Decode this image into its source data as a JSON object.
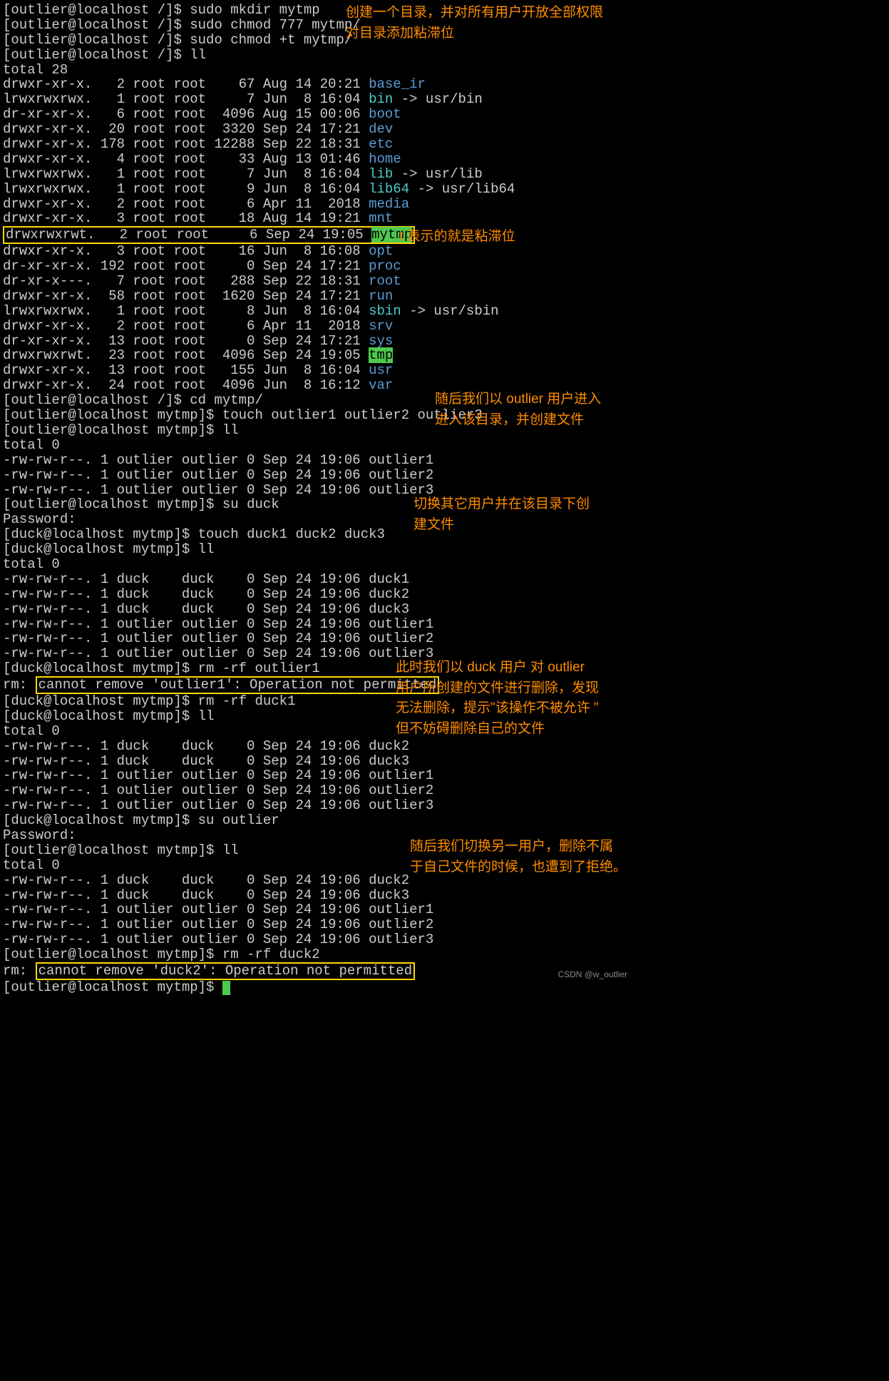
{
  "annotations": {
    "a1_l1": "创建一个目录，并对所有用户开放全部权限",
    "a1_l2": "对目录添加粘滞位",
    "a2": "t 表示的就是粘滞位",
    "a3_l1": "随后我们以 outlier 用户进入",
    "a3_l2": "进入该目录，并创建文件",
    "a4_l1": "切换其它用户并在该目录下创",
    "a4_l2": "建文件",
    "a5_l1": "此时我们以 duck 用户 对 outlier",
    "a5_l2": "用户所创建的文件进行删除，发现",
    "a5_l3": "无法删除，提示\"该操作不被允许  \"",
    "a5_l4": "但不妨碍删除自己的文件",
    "a6_l1": "随后我们切换另一用户，删除不属",
    "a6_l2": "于自己文件的时候，也遭到了拒绝。"
  },
  "prompts": {
    "outlier_root": "[outlier@localhost /]$ ",
    "outlier_mytmp": "[outlier@localhost mytmp]$ ",
    "duck_mytmp": "[duck@localhost mytmp]$ "
  },
  "cmds": {
    "mkdir": "sudo mkdir mytmp",
    "chmod777": "sudo chmod 777 mytmp/",
    "chmodt": "sudo chmod +t mytmp/",
    "ll": "ll",
    "cd": "cd mytmp/",
    "touch_out": "touch outlier1 outlier2 outlier3",
    "su_duck": "su duck",
    "touch_duck": "touch duck1 duck2 duck3",
    "rm_out1": "rm -rf outlier1",
    "rm_duck1": "rm -rf duck1",
    "su_out": "su outlier",
    "rm_duck2": "rm -rf duck2"
  },
  "text": {
    "total28": "total 28",
    "total0": "total 0",
    "password": "Password:",
    "rm_prefix": "rm: ",
    "err1": "cannot remove 'outlier1': Operation not permitted",
    "err2": "cannot remove 'duck2': Operation not permitted"
  },
  "ll_root": [
    {
      "perm": "drwxr-xr-x.",
      "n": "  2",
      "o": "root root",
      "sz": "   67",
      "dt": "Aug 14 20:21",
      "nm": "base_ir",
      "c": "blue"
    },
    {
      "perm": "lrwxrwxrwx.",
      "n": "  1",
      "o": "root root",
      "sz": "    7",
      "dt": "Jun  8 16:04",
      "nm": "bin",
      "link": " -> usr/bin",
      "c": "cyan"
    },
    {
      "perm": "dr-xr-xr-x.",
      "n": "  6",
      "o": "root root",
      "sz": " 4096",
      "dt": "Aug 15 00:06",
      "nm": "boot",
      "c": "blue"
    },
    {
      "perm": "drwxr-xr-x.",
      "n": " 20",
      "o": "root root",
      "sz": " 3320",
      "dt": "Sep 24 17:21",
      "nm": "dev",
      "c": "blue"
    },
    {
      "perm": "drwxr-xr-x.",
      "n": "178",
      "o": "root root",
      "sz": "12288",
      "dt": "Sep 22 18:31",
      "nm": "etc",
      "c": "blue"
    },
    {
      "perm": "drwxr-xr-x.",
      "n": "  4",
      "o": "root root",
      "sz": "   33",
      "dt": "Aug 13 01:46",
      "nm": "home",
      "c": "blue"
    },
    {
      "perm": "lrwxrwxrwx.",
      "n": "  1",
      "o": "root root",
      "sz": "    7",
      "dt": "Jun  8 16:04",
      "nm": "lib",
      "link": " -> usr/lib",
      "c": "cyan"
    },
    {
      "perm": "lrwxrwxrwx.",
      "n": "  1",
      "o": "root root",
      "sz": "    9",
      "dt": "Jun  8 16:04",
      "nm": "lib64",
      "link": " -> usr/lib64",
      "c": "cyan"
    },
    {
      "perm": "drwxr-xr-x.",
      "n": "  2",
      "o": "root root",
      "sz": "    6",
      "dt": "Apr 11  2018",
      "nm": "media",
      "c": "blue"
    },
    {
      "perm": "drwxr-xr-x.",
      "n": "  3",
      "o": "root root",
      "sz": "   18",
      "dt": "Aug 14 19:21",
      "nm": "mnt",
      "c": "blue"
    },
    {
      "perm": "drwxrwxrwt.",
      "n": "  2",
      "o": "root root",
      "sz": "    6",
      "dt": "Sep 24 19:05",
      "nm": "mytmp",
      "c": "hl-green",
      "boxed": true
    },
    {
      "perm": "drwxr-xr-x.",
      "n": "  3",
      "o": "root root",
      "sz": "   16",
      "dt": "Jun  8 16:08",
      "nm": "opt",
      "c": "blue"
    },
    {
      "perm": "dr-xr-xr-x.",
      "n": "192",
      "o": "root root",
      "sz": "    0",
      "dt": "Sep 24 17:21",
      "nm": "proc",
      "c": "blue"
    },
    {
      "perm": "dr-xr-x---.",
      "n": "  7",
      "o": "root root",
      "sz": "  288",
      "dt": "Sep 22 18:31",
      "nm": "root",
      "c": "blue"
    },
    {
      "perm": "drwxr-xr-x.",
      "n": " 58",
      "o": "root root",
      "sz": " 1620",
      "dt": "Sep 24 17:21",
      "nm": "run",
      "c": "blue"
    },
    {
      "perm": "lrwxrwxrwx.",
      "n": "  1",
      "o": "root root",
      "sz": "    8",
      "dt": "Jun  8 16:04",
      "nm": "sbin",
      "link": " -> usr/sbin",
      "c": "cyan"
    },
    {
      "perm": "drwxr-xr-x.",
      "n": "  2",
      "o": "root root",
      "sz": "    6",
      "dt": "Apr 11  2018",
      "nm": "srv",
      "c": "blue"
    },
    {
      "perm": "dr-xr-xr-x.",
      "n": " 13",
      "o": "root root",
      "sz": "    0",
      "dt": "Sep 24 17:21",
      "nm": "sys",
      "c": "blue"
    },
    {
      "perm": "drwxrwxrwt.",
      "n": " 23",
      "o": "root root",
      "sz": " 4096",
      "dt": "Sep 24 19:05",
      "nm": "tmp",
      "c": "hl-green"
    },
    {
      "perm": "drwxr-xr-x.",
      "n": " 13",
      "o": "root root",
      "sz": "  155",
      "dt": "Jun  8 16:04",
      "nm": "usr",
      "c": "blue"
    },
    {
      "perm": "drwxr-xr-x.",
      "n": " 24",
      "o": "root root",
      "sz": " 4096",
      "dt": "Jun  8 16:12",
      "nm": "var",
      "c": "blue"
    }
  ],
  "ll_out": [
    {
      "perm": "-rw-rw-r--.",
      "n": "1",
      "o": "outlier outlier",
      "sz": "0",
      "dt": "Sep 24 19:06",
      "nm": "outlier1"
    },
    {
      "perm": "-rw-rw-r--.",
      "n": "1",
      "o": "outlier outlier",
      "sz": "0",
      "dt": "Sep 24 19:06",
      "nm": "outlier2"
    },
    {
      "perm": "-rw-rw-r--.",
      "n": "1",
      "o": "outlier outlier",
      "sz": "0",
      "dt": "Sep 24 19:06",
      "nm": "outlier3"
    }
  ],
  "ll_mix": [
    {
      "perm": "-rw-rw-r--.",
      "n": "1",
      "o": "duck    duck   ",
      "sz": "0",
      "dt": "Sep 24 19:06",
      "nm": "duck1"
    },
    {
      "perm": "-rw-rw-r--.",
      "n": "1",
      "o": "duck    duck   ",
      "sz": "0",
      "dt": "Sep 24 19:06",
      "nm": "duck2"
    },
    {
      "perm": "-rw-rw-r--.",
      "n": "1",
      "o": "duck    duck   ",
      "sz": "0",
      "dt": "Sep 24 19:06",
      "nm": "duck3"
    },
    {
      "perm": "-rw-rw-r--.",
      "n": "1",
      "o": "outlier outlier",
      "sz": "0",
      "dt": "Sep 24 19:06",
      "nm": "outlier1"
    },
    {
      "perm": "-rw-rw-r--.",
      "n": "1",
      "o": "outlier outlier",
      "sz": "0",
      "dt": "Sep 24 19:06",
      "nm": "outlier2"
    },
    {
      "perm": "-rw-rw-r--.",
      "n": "1",
      "o": "outlier outlier",
      "sz": "0",
      "dt": "Sep 24 19:06",
      "nm": "outlier3"
    }
  ],
  "ll_after1": [
    {
      "perm": "-rw-rw-r--.",
      "n": "1",
      "o": "duck    duck   ",
      "sz": "0",
      "dt": "Sep 24 19:06",
      "nm": "duck2"
    },
    {
      "perm": "-rw-rw-r--.",
      "n": "1",
      "o": "duck    duck   ",
      "sz": "0",
      "dt": "Sep 24 19:06",
      "nm": "duck3"
    },
    {
      "perm": "-rw-rw-r--.",
      "n": "1",
      "o": "outlier outlier",
      "sz": "0",
      "dt": "Sep 24 19:06",
      "nm": "outlier1"
    },
    {
      "perm": "-rw-rw-r--.",
      "n": "1",
      "o": "outlier outlier",
      "sz": "0",
      "dt": "Sep 24 19:06",
      "nm": "outlier2"
    },
    {
      "perm": "-rw-rw-r--.",
      "n": "1",
      "o": "outlier outlier",
      "sz": "0",
      "dt": "Sep 24 19:06",
      "nm": "outlier3"
    }
  ],
  "watermark": "CSDN @w_outlier"
}
